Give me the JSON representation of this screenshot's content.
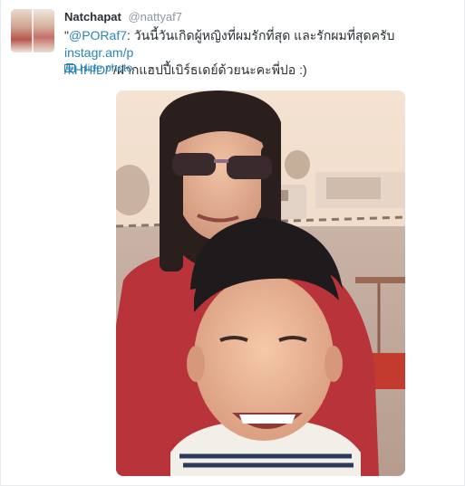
{
  "tweet": {
    "fullname": "Natchapat",
    "username": "@nattyaf7",
    "text_prefix": "\"",
    "mention": "@PORaf7",
    "body_text": ": วันนี้วันเกิดผู้หญิงที่ผมรักที่สุด และรักผมที่สุดครับ ",
    "link_line1": "instagr.am/p",
    "link_line2": "/kHHfD/",
    "suffix": "\"/ฝากแฮปปี้เบิร์ธเดย์ด้วยนะคะพี่ปอ :)",
    "hide_photo_label": "Hide photo"
  },
  "icons": {
    "photo": "photo-icon"
  }
}
